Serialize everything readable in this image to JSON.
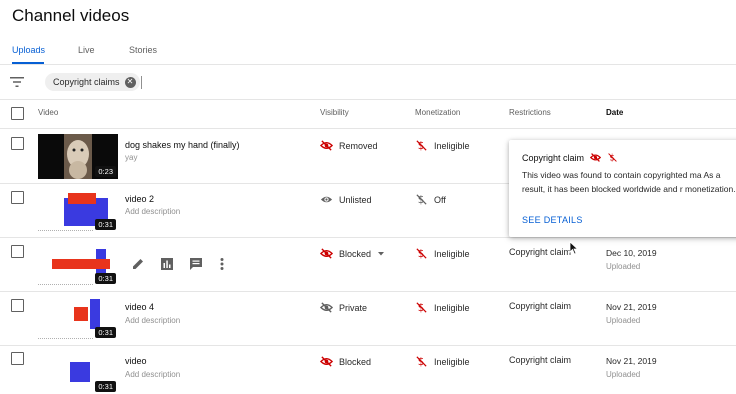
{
  "page": {
    "title": "Channel videos"
  },
  "tabs": [
    {
      "label": "Uploads",
      "active": true
    },
    {
      "label": "Live",
      "active": false
    },
    {
      "label": "Stories",
      "active": false
    }
  ],
  "filter": {
    "chip_label": "Copyright claims",
    "icon": "filter-icon"
  },
  "columns": {
    "video": "Video",
    "visibility": "Visibility",
    "monetization": "Monetization",
    "restrictions": "Restrictions",
    "date": "Date"
  },
  "rows": [
    {
      "title": "dog shakes my hand (finally)",
      "description": "yay",
      "duration": "0:23",
      "visibility": "Removed",
      "visibility_icon": "removed-eye-icon",
      "monetization": "Ineligible",
      "restrictions": "",
      "date": "",
      "date_status": ""
    },
    {
      "title": "video 2",
      "description": "Add description",
      "duration": "0:31",
      "visibility": "Unlisted",
      "visibility_icon": "eye-icon",
      "monetization": "Off",
      "restrictions": "",
      "date": "",
      "date_status": ""
    },
    {
      "title": "",
      "description": "",
      "duration": "0:31",
      "visibility": "Blocked",
      "visibility_icon": "blocked-eye-icon",
      "monetization": "Ineligible",
      "restrictions": "Copyright claim",
      "date": "Dec 10, 2019",
      "date_status": "Uploaded"
    },
    {
      "title": "video 4",
      "description": "Add description",
      "duration": "0:31",
      "visibility": "Private",
      "visibility_icon": "private-eye-icon",
      "monetization": "Ineligible",
      "restrictions": "Copyright claim",
      "date": "Nov 21, 2019",
      "date_status": "Uploaded"
    },
    {
      "title": "video",
      "description": "Add description",
      "duration": "0:31",
      "visibility": "Blocked",
      "visibility_icon": "blocked-eye-icon",
      "monetization": "Ineligible",
      "restrictions": "Copyright claim",
      "date": "Nov 21, 2019",
      "date_status": "Uploaded"
    }
  ],
  "popup": {
    "title": "Copyright claim",
    "body": "This video was found to contain copyrighted ma As a result, it has been blocked worldwide and r monetization.",
    "link": "SEE DETAILS"
  },
  "colors": {
    "accent": "#065fd4",
    "danger": "#cc0000",
    "thumb_red": "#e8341c",
    "thumb_blue": "#3a3ae0"
  }
}
